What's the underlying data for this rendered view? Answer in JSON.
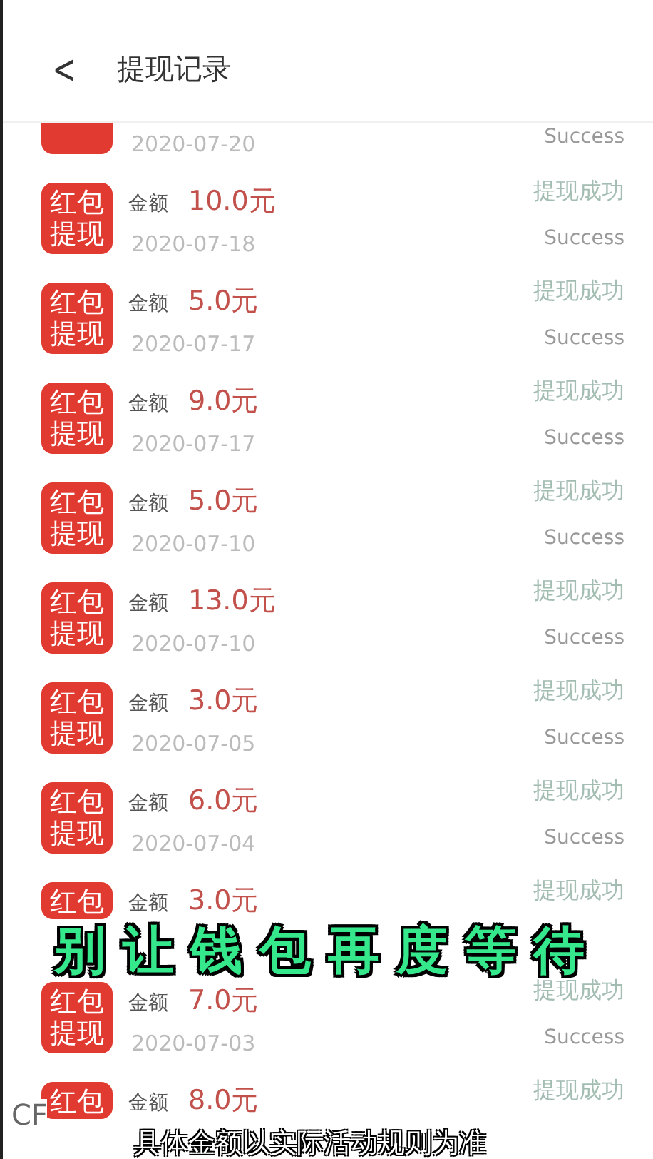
{
  "header": {
    "back": "<",
    "title": "提现记录"
  },
  "records": [
    {
      "kind": "cut",
      "date": "2020-07-20",
      "status_en": "Success"
    },
    {
      "kind": "full",
      "badge": [
        "红包",
        "提现"
      ],
      "label": "金额",
      "amount": "10.0元",
      "status": "提现成功",
      "date": "2020-07-18",
      "status_en": "Success"
    },
    {
      "kind": "full",
      "badge": [
        "红包",
        "提现"
      ],
      "label": "金额",
      "amount": "5.0元",
      "status": "提现成功",
      "date": "2020-07-17",
      "status_en": "Success"
    },
    {
      "kind": "full",
      "badge": [
        "红包",
        "提现"
      ],
      "label": "金额",
      "amount": "9.0元",
      "status": "提现成功",
      "date": "2020-07-17",
      "status_en": "Success"
    },
    {
      "kind": "full",
      "badge": [
        "红包",
        "提现"
      ],
      "label": "金额",
      "amount": "5.0元",
      "status": "提现成功",
      "date": "2020-07-10",
      "status_en": "Success"
    },
    {
      "kind": "full",
      "badge": [
        "红包",
        "提现"
      ],
      "label": "金额",
      "amount": "13.0元",
      "status": "提现成功",
      "date": "2020-07-10",
      "status_en": "Success"
    },
    {
      "kind": "full",
      "badge": [
        "红包",
        "提现"
      ],
      "label": "金额",
      "amount": "3.0元",
      "status": "提现成功",
      "date": "2020-07-05",
      "status_en": "Success"
    },
    {
      "kind": "full",
      "badge": [
        "红包",
        "提现"
      ],
      "label": "金额",
      "amount": "6.0元",
      "status": "提现成功",
      "date": "2020-07-04",
      "status_en": "Success"
    },
    {
      "kind": "covered",
      "badge": [
        "红包"
      ],
      "label": "金额",
      "amount": "3.0元",
      "status": "提现成功"
    },
    {
      "kind": "full",
      "badge": [
        "红包",
        "提现"
      ],
      "label": "金额",
      "amount": "7.0元",
      "status": "提现成功",
      "date": "2020-07-03",
      "status_en": "Success"
    },
    {
      "kind": "covered",
      "badge": [
        "红包"
      ],
      "label": "金额",
      "amount": "8.0元",
      "status": "提现成功"
    }
  ],
  "overlay": {
    "caption": "别让钱包再度等待",
    "subtitle": "具体金额以实际活动规则为准",
    "corner": "CF"
  }
}
